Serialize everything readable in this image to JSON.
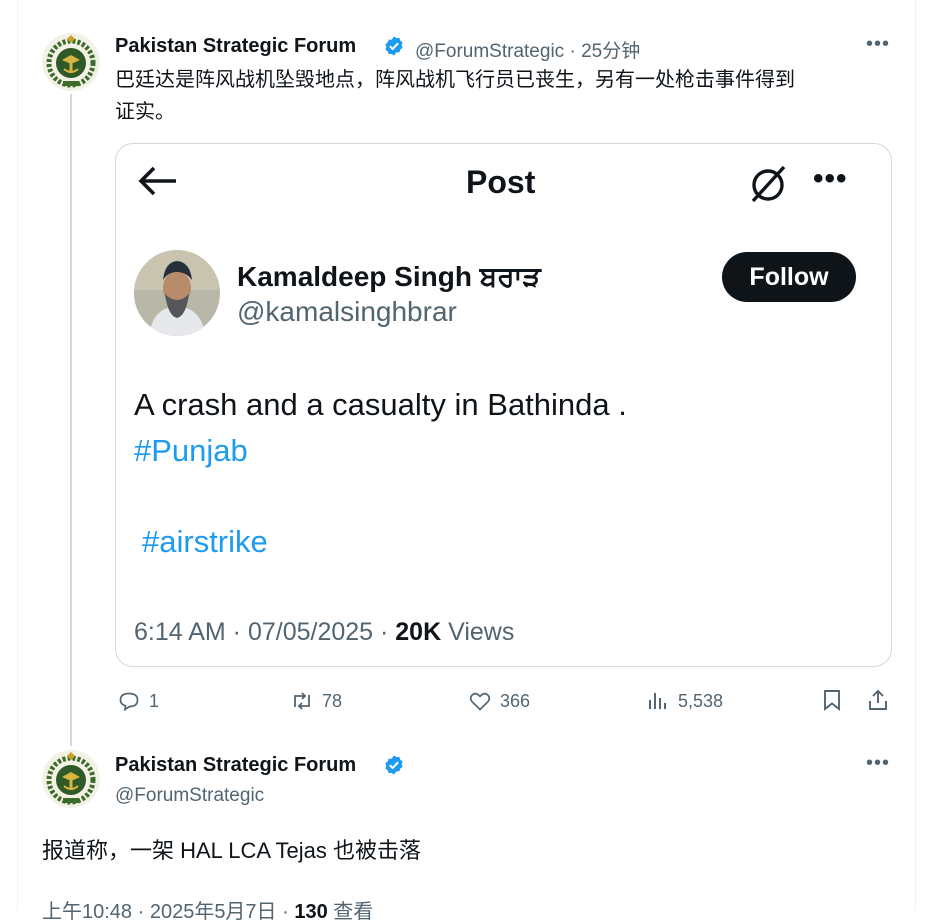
{
  "tweet1": {
    "author_name": "Pakistan Strategic Forum",
    "handle": "@ForumStrategic",
    "time": "25分钟",
    "text_line1": "巴廷达是阵风战机坠毁地点，阵风战机飞行员已丧生，另有一处枪击事件得到",
    "text_line2": "证实。",
    "quoted": {
      "header_title": "Post",
      "author_name": "Kamaldeep Singh ਬਰਾੜ",
      "handle": "@kamalsinghbrar",
      "follow_label": "Follow",
      "body": "A crash and a casualty in Bathinda .",
      "hashtag1": "#Punjab",
      "hashtag2": "#airstrike",
      "meta_time": "6:14 AM · 07/05/2025 · ",
      "views_count": "20K",
      "views_label": " Views"
    },
    "actions": {
      "replies": "1",
      "reposts": "78",
      "likes": "366",
      "views": "5,538"
    }
  },
  "tweet2": {
    "author_name": "Pakistan Strategic Forum",
    "handle": "@ForumStrategic",
    "text": "报道称，一架 HAL LCA Tejas 也被击落",
    "meta_time": "上午10:48 · 2025年5月7日 · ",
    "views_count": "130",
    "views_label": " 查看"
  },
  "colors": {
    "verified": "#1d9bf0",
    "link": "#1d9bf0",
    "secondary_text": "#536471"
  },
  "icons": [
    "more-icon",
    "verified-badge-icon",
    "back-arrow-icon",
    "grok-icon",
    "reply-icon",
    "repost-icon",
    "like-icon",
    "views-icon",
    "bookmark-icon",
    "share-icon"
  ]
}
